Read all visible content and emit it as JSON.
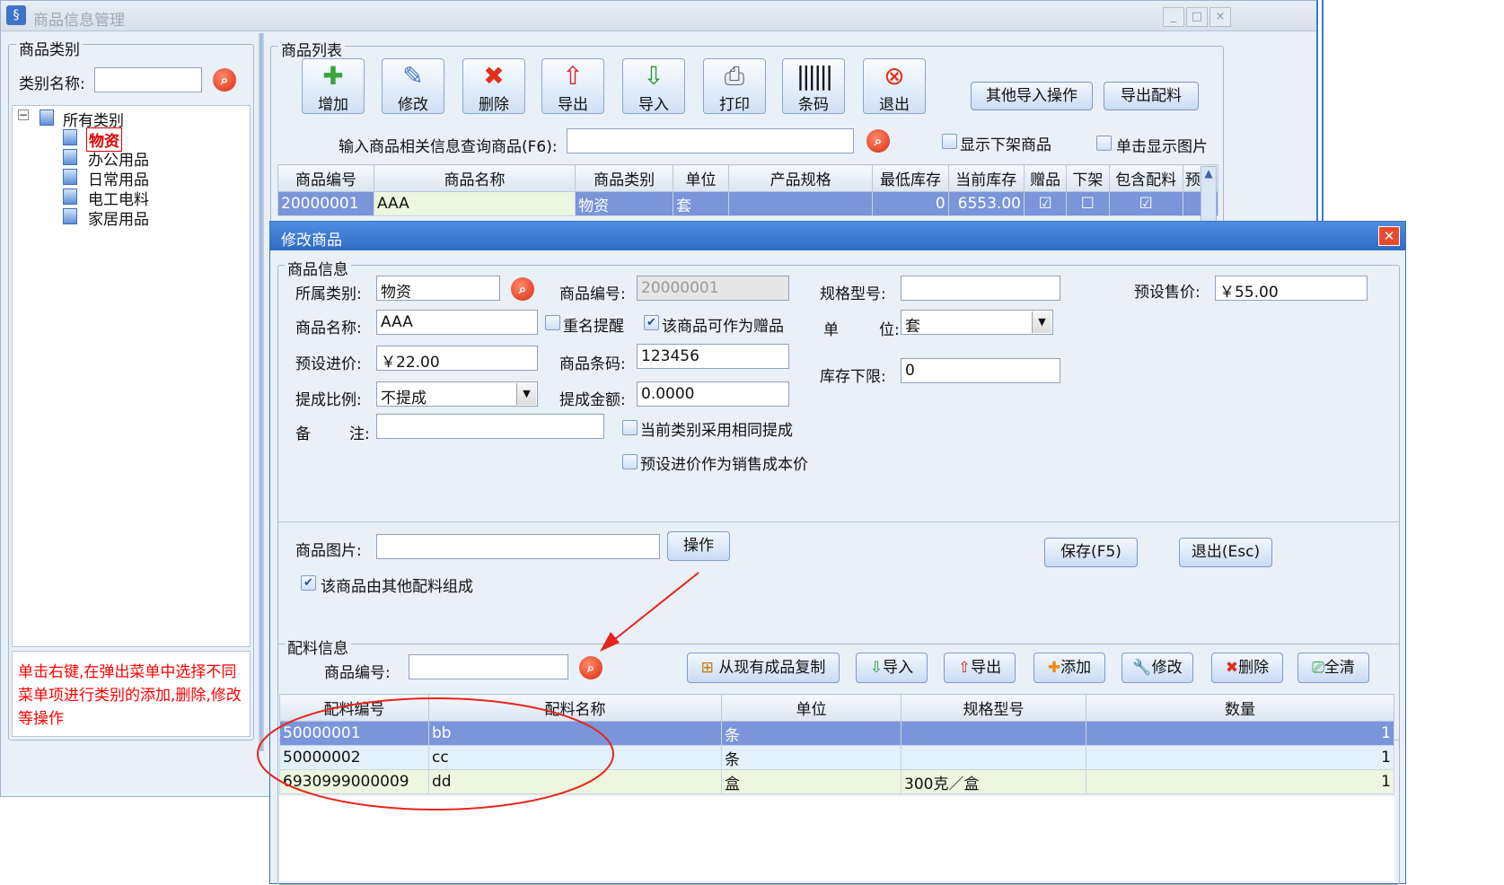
{
  "main_window": {
    "title": "商品信息管理",
    "controls": [
      "_",
      "□",
      "×"
    ],
    "category_panel": {
      "legend": "商品类别",
      "search_label": "类别名称:",
      "tree": {
        "root": "所有类别",
        "items": [
          "物资",
          "办公用品",
          "日常用品",
          "电工电料",
          "家居用品"
        ],
        "selected": "物资"
      },
      "hint": "单击右键,在弹出菜单中选择不同菜单项进行类别的添加,删除,修改等操作",
      "hint_color": "#ff0000"
    },
    "product_panel": {
      "legend": "商品列表",
      "toolbar": [
        {
          "label": "增加",
          "icon": "add-doc-icon"
        },
        {
          "label": "修改",
          "icon": "edit-doc-icon"
        },
        {
          "label": "删除",
          "icon": "delete-x-icon"
        },
        {
          "label": "导出",
          "icon": "up-arrow-icon"
        },
        {
          "label": "导入",
          "icon": "down-arrow-icon"
        },
        {
          "label": "打印",
          "icon": "printer-icon"
        },
        {
          "label": "条码",
          "icon": "barcode-icon"
        },
        {
          "label": "退出",
          "icon": "exit-icon"
        }
      ],
      "other_import": "其他导入操作",
      "export_parts": "导出配料",
      "query_label": "输入商品相关信息查询商品(F6):",
      "query_value": "",
      "show_offshelf": "显示下架商品",
      "click_show_image": "单击显示图片",
      "columns": [
        "商品编号",
        "商品名称",
        "商品类别",
        "单位",
        "产品规格",
        "最低库存",
        "当前库存",
        "赠品",
        "下架",
        "包含配料",
        "预设"
      ],
      "rows": [
        {
          "id": "20000001",
          "name": "AAA",
          "category": "物资",
          "unit": "套",
          "spec": "",
          "min_stock": "0",
          "stock": "6553.00",
          "gift": true,
          "offshelf": false,
          "has_parts": true,
          "preset": "¥"
        }
      ]
    }
  },
  "dialog": {
    "title": "修改商品",
    "info_legend": "商品信息",
    "fields": {
      "category_label": "所属类别:",
      "category_value": "物资",
      "code_label": "商品编号:",
      "code_value": "20000001",
      "spec_label": "规格型号:",
      "spec_value": "",
      "sale_price_label": "预设售价:",
      "sale_price_value": "￥55.00",
      "name_label": "商品名称:",
      "name_value": "AAA",
      "dup_remind": "重名提醒",
      "as_gift": "该商品可作为赠品",
      "unit_label_a": "单",
      "unit_label_b": "位:",
      "unit_value": "套",
      "cost_label": "预设进价:",
      "cost_value": "￥22.00",
      "barcode_label": "商品条码:",
      "barcode_value": "123456",
      "min_stock_label": "库存下限:",
      "min_stock_value": "0",
      "commission_ratio_label": "提成比例:",
      "commission_ratio_value": "不提成",
      "commission_amount_label": "提成金额:",
      "commission_amount_value": "0.0000",
      "remark_label_a": "备",
      "remark_label_b": "注:",
      "remark_value": "",
      "same_commission": "当前类别采用相同提成",
      "cost_as_sale_cost": "预设进价作为销售成本价",
      "image_label": "商品图片:",
      "image_value": "",
      "operate": "操作",
      "save": "保存(F5)",
      "exit": "退出(Esc)",
      "composed": "该商品由其他配料组成"
    },
    "parts": {
      "legend": "配料信息",
      "code_label": "商品编号:",
      "code_value": "",
      "buttons": [
        {
          "label": "从现有成品复制",
          "icon": "copy-plus-icon"
        },
        {
          "label": "导入",
          "icon": "import-icon"
        },
        {
          "label": "导出",
          "icon": "export-icon"
        },
        {
          "label": "添加",
          "icon": "plus-icon"
        },
        {
          "label": "修改",
          "icon": "wrench-icon"
        },
        {
          "label": "删除",
          "icon": "delete-x-icon"
        },
        {
          "label": "全清",
          "icon": "clear-icon"
        }
      ],
      "columns": [
        "配料编号",
        "配料名称",
        "单位",
        "规格型号",
        "数量"
      ],
      "rows": [
        {
          "code": "50000001",
          "name": "bb",
          "unit": "条",
          "spec": "",
          "qty": "1"
        },
        {
          "code": "50000002",
          "name": "cc",
          "unit": "条",
          "spec": "",
          "qty": "1"
        },
        {
          "code": "6930999000009",
          "name": "dd",
          "unit": "盒",
          "spec": "300克／盒",
          "qty": "1"
        }
      ]
    }
  },
  "colors": {
    "selected_row": "#7b95da",
    "alt_row": "#e2f1fb",
    "green_row": "#edf6de",
    "annotation_red": "#e8241c",
    "dialog_title": "#3a78d1"
  }
}
